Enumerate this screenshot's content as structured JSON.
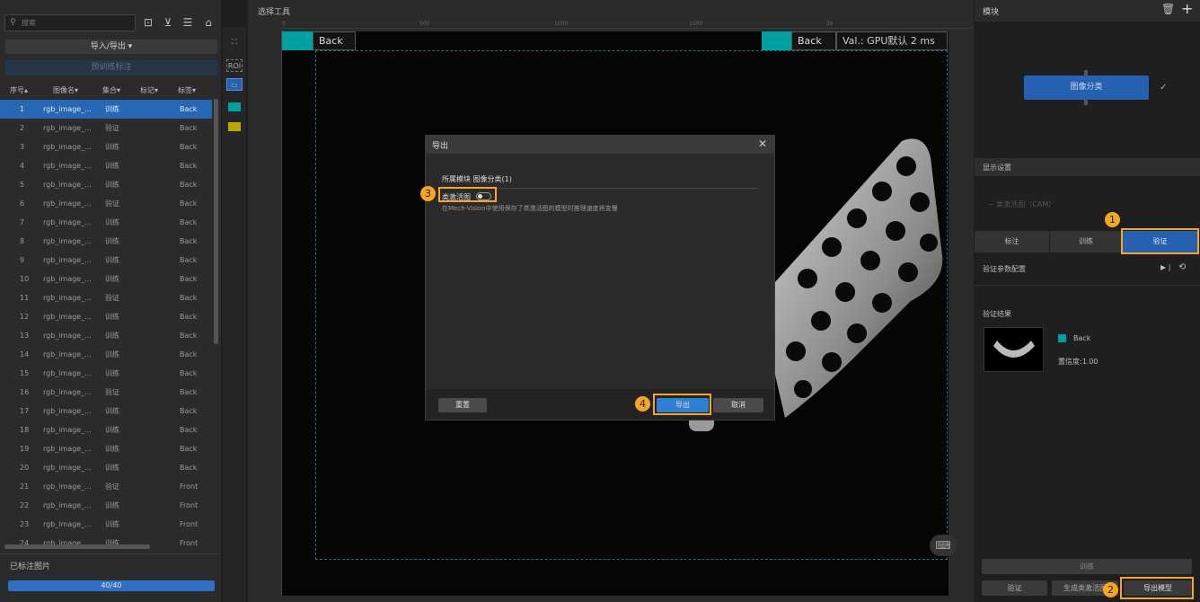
{
  "search": {
    "placeholder": "搜索"
  },
  "left_toolbar": {
    "import_export": "导入/导出 ▾",
    "pretrain": "预训练标注"
  },
  "table": {
    "headers": [
      "序号▴",
      "图像名▾",
      "集合▾",
      "标记▾",
      "标签▾"
    ],
    "rows": [
      {
        "no": "1",
        "name": "rgb_image_...",
        "set": "训练",
        "tag": "Back"
      },
      {
        "no": "2",
        "name": "rgb_image_...",
        "set": "验证",
        "tag": "Back"
      },
      {
        "no": "3",
        "name": "rgb_image_...",
        "set": "训练",
        "tag": "Back"
      },
      {
        "no": "4",
        "name": "rgb_image_...",
        "set": "训练",
        "tag": "Back"
      },
      {
        "no": "5",
        "name": "rgb_image_...",
        "set": "训练",
        "tag": "Back"
      },
      {
        "no": "6",
        "name": "rgb_image_...",
        "set": "验证",
        "tag": "Back"
      },
      {
        "no": "7",
        "name": "rgb_image_...",
        "set": "训练",
        "tag": "Back"
      },
      {
        "no": "8",
        "name": "rgb_image_...",
        "set": "训练",
        "tag": "Back"
      },
      {
        "no": "9",
        "name": "rgb_image_...",
        "set": "训练",
        "tag": "Back"
      },
      {
        "no": "10",
        "name": "rgb_image_...",
        "set": "训练",
        "tag": "Back"
      },
      {
        "no": "11",
        "name": "rgb_image_...",
        "set": "验证",
        "tag": "Back"
      },
      {
        "no": "12",
        "name": "rgb_image_...",
        "set": "训练",
        "tag": "Back"
      },
      {
        "no": "13",
        "name": "rgb_image_...",
        "set": "训练",
        "tag": "Back"
      },
      {
        "no": "14",
        "name": "rgb_image_...",
        "set": "训练",
        "tag": "Back"
      },
      {
        "no": "15",
        "name": "rgb_image_...",
        "set": "训练",
        "tag": "Back"
      },
      {
        "no": "16",
        "name": "rgb_image_...",
        "set": "验证",
        "tag": "Back"
      },
      {
        "no": "17",
        "name": "rgb_image_...",
        "set": "训练",
        "tag": "Back"
      },
      {
        "no": "18",
        "name": "rgb_image_...",
        "set": "训练",
        "tag": "Back"
      },
      {
        "no": "19",
        "name": "rgb_image_...",
        "set": "训练",
        "tag": "Back"
      },
      {
        "no": "20",
        "name": "rgb_image_...",
        "set": "训练",
        "tag": "Back"
      },
      {
        "no": "21",
        "name": "rgb_image_...",
        "set": "验证",
        "tag": "Front"
      },
      {
        "no": "22",
        "name": "rgb_image_...",
        "set": "训练",
        "tag": "Front"
      },
      {
        "no": "23",
        "name": "rgb_image_...",
        "set": "训练",
        "tag": "Front"
      },
      {
        "no": "24",
        "name": "rgb_image_...",
        "set": "训练",
        "tag": "Front"
      }
    ]
  },
  "labeled": {
    "title": "已标注图片",
    "progress_text": "40/40",
    "progress": 1.0
  },
  "canvas": {
    "select_tool": "选择工具",
    "ruler_top": [
      "0",
      "500",
      "1000",
      "1500",
      "2k"
    ],
    "tag_left": "Back",
    "tag_right": "Back",
    "val_text": "Val.: GPU默认 2 ms",
    "roi": "ROI",
    "teal": "#00a0a0",
    "yellow": "#b8a800"
  },
  "modal": {
    "title": "导出",
    "close": "✕",
    "module_label": "所属模块 图像分类(1)",
    "cam_label": "类激活图",
    "cam_hint": "在Mech-Vision中使用保存了类激活图的模型时推理速度将变慢",
    "reset": "重置",
    "export": "导出",
    "cancel": "取消"
  },
  "callouts": [
    "1",
    "2",
    "3",
    "4"
  ],
  "right": {
    "module_title": "模块",
    "node_label": "图像分类",
    "display_settings": "显示设置",
    "cam_option": "~ 类激活图（CAM）",
    "tabs": [
      "标注",
      "训练",
      "验证"
    ],
    "verify_params": "验证参数配置",
    "verify_result": "验证结果",
    "result_class": "Back",
    "result_conf": "置信度:1.00",
    "train_button": "训练",
    "verify_button": "验证",
    "gen_cam_button": "生成类激活图",
    "export_model_button": "导出模型",
    "accent": "#2561b0",
    "highlight": "#f5a623"
  }
}
